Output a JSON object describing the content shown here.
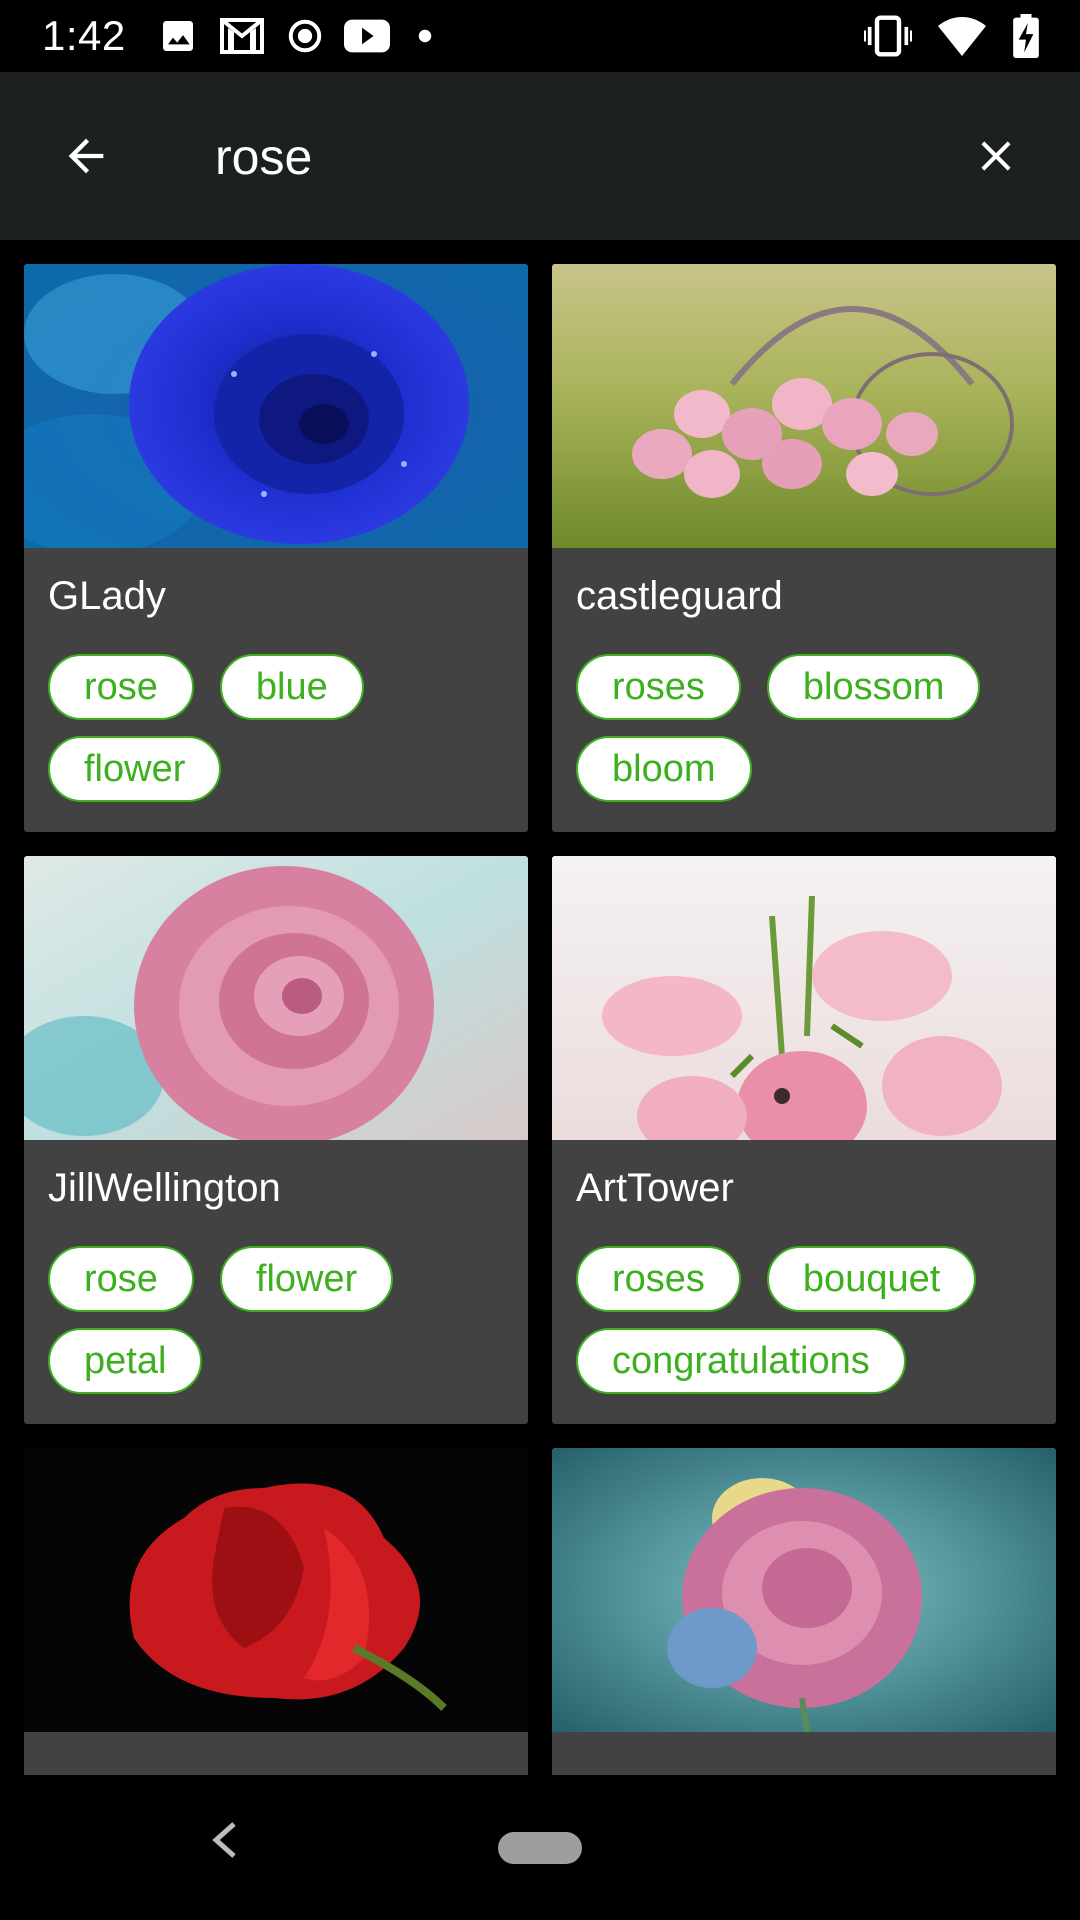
{
  "status_bar": {
    "time": "1:42",
    "left_icons": [
      "photo-icon",
      "gmail-icon",
      "record-icon",
      "youtube-icon",
      "dot-icon"
    ],
    "right_icons": [
      "vibrate-icon",
      "wifi-icon",
      "battery-charging-icon"
    ]
  },
  "search": {
    "query": "rose",
    "back_icon": "arrow-back-icon",
    "clear_icon": "close-icon"
  },
  "results": [
    {
      "user": "GLady",
      "tags": [
        "rose",
        "blue",
        "flower"
      ],
      "image": "blue rose photo"
    },
    {
      "user": "castleguard",
      "tags": [
        "roses",
        "blossom",
        "bloom"
      ],
      "image": "pink roses in basket photo"
    },
    {
      "user": "JillWellington",
      "tags": [
        "rose",
        "flower",
        "petal"
      ],
      "image": "pink rose closeup photo"
    },
    {
      "user": "ArtTower",
      "tags": [
        "roses",
        "bouquet",
        "congratulations"
      ],
      "image": "pink roses bouquet photo"
    },
    {
      "user": "",
      "tags": [],
      "image": "red rose photo"
    },
    {
      "user": "",
      "tags": [],
      "image": "rainbow rose photo"
    }
  ],
  "colors": {
    "background": "#000000",
    "header": "#1c2120",
    "card": "#424242",
    "tag_text": "#3cb01e",
    "tag_bg": "#ffffff"
  },
  "nav_bar": {
    "back_icon": "nav-back-icon",
    "home_icon": "nav-home-pill"
  }
}
